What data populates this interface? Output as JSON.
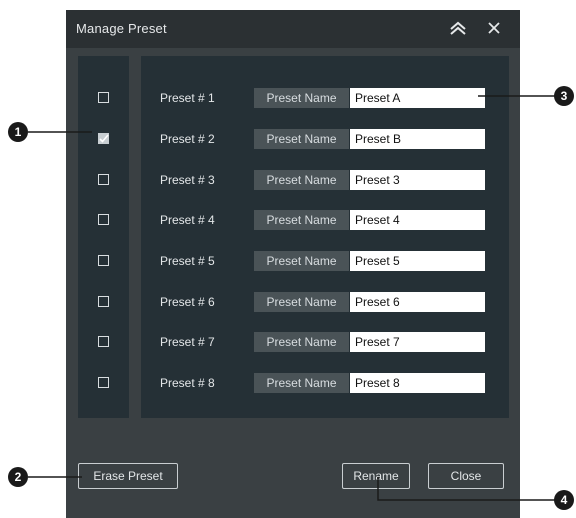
{
  "dialog": {
    "title": "Manage Preset",
    "collapse_icon": "double-chevron-up-icon",
    "close_icon": "close-icon"
  },
  "presets": [
    {
      "label": "Preset # 1",
      "tag": "Preset Name",
      "name": "Preset A",
      "checked": false
    },
    {
      "label": "Preset # 2",
      "tag": "Preset Name",
      "name": "Preset B",
      "checked": true
    },
    {
      "label": "Preset # 3",
      "tag": "Preset Name",
      "name": "Preset 3",
      "checked": false
    },
    {
      "label": "Preset # 4",
      "tag": "Preset Name",
      "name": "Preset 4",
      "checked": false
    },
    {
      "label": "Preset # 5",
      "tag": "Preset Name",
      "name": "Preset 5",
      "checked": false
    },
    {
      "label": "Preset # 6",
      "tag": "Preset Name",
      "name": "Preset 6",
      "checked": false
    },
    {
      "label": "Preset # 7",
      "tag": "Preset Name",
      "name": "Preset 7",
      "checked": false
    },
    {
      "label": "Preset # 8",
      "tag": "Preset Name",
      "name": "Preset 8",
      "checked": false
    }
  ],
  "buttons": {
    "erase": "Erase Preset",
    "rename": "Rename",
    "close": "Close"
  },
  "callouts": [
    "1",
    "2",
    "3",
    "4"
  ],
  "colors": {
    "dialog_bg": "#3a4043",
    "titlebar_bg": "#2b3033",
    "panel_bg": "#253036",
    "tag_bg": "#4a5357",
    "input_bg": "#ffffff"
  }
}
